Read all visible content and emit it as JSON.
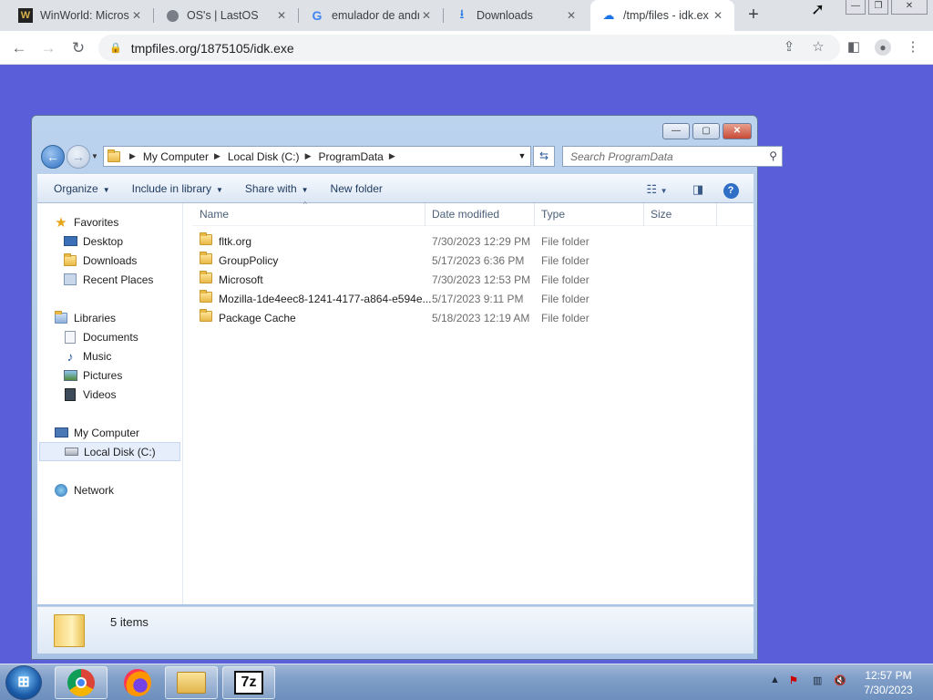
{
  "browser": {
    "tabs": [
      {
        "title": "WinWorld: Micros",
        "icon": "winworld-icon",
        "active": false
      },
      {
        "title": "OS's | LastOS",
        "icon": "globe-icon",
        "active": false
      },
      {
        "title": "emulador de andr",
        "icon": "google-icon",
        "active": false
      },
      {
        "title": "Downloads",
        "icon": "download-icon",
        "active": false
      },
      {
        "title": "/tmp/files - idk.ex",
        "icon": "cloud-upload-icon",
        "active": true
      }
    ],
    "url": "tmpfiles.org/1875105/idk.exe"
  },
  "explorer": {
    "breadcrumb": [
      "My Computer",
      "Local Disk (C:)",
      "ProgramData"
    ],
    "search_placeholder": "Search ProgramData",
    "toolbar": {
      "organize": "Organize",
      "include_in_library": "Include in library",
      "share_with": "Share with",
      "new_folder": "New folder"
    },
    "nav": {
      "favorites": "Favorites",
      "desktop": "Desktop",
      "downloads": "Downloads",
      "recent_places": "Recent Places",
      "libraries": "Libraries",
      "documents": "Documents",
      "music": "Music",
      "pictures": "Pictures",
      "videos": "Videos",
      "my_computer": "My Computer",
      "local_disk": "Local Disk (C:)",
      "network": "Network"
    },
    "columns": {
      "name": "Name",
      "date": "Date modified",
      "type": "Type",
      "size": "Size"
    },
    "files": [
      {
        "name": "fltk.org",
        "date": "7/30/2023 12:29 PM",
        "type": "File folder",
        "size": ""
      },
      {
        "name": "GroupPolicy",
        "date": "5/17/2023 6:36 PM",
        "type": "File folder",
        "size": ""
      },
      {
        "name": "Microsoft",
        "date": "7/30/2023 12:53 PM",
        "type": "File folder",
        "size": ""
      },
      {
        "name": "Mozilla-1de4eec8-1241-4177-a864-e594e...",
        "date": "5/17/2023 9:11 PM",
        "type": "File folder",
        "size": ""
      },
      {
        "name": "Package Cache",
        "date": "5/18/2023 12:19 AM",
        "type": "File folder",
        "size": ""
      }
    ],
    "status": "5 items"
  },
  "taskbar": {
    "apps": [
      "chrome-icon",
      "firefox-icon",
      "explorer-icon",
      "7zip-icon"
    ],
    "seven_zip_label": "7z",
    "time": "12:57 PM",
    "date": "7/30/2023"
  }
}
